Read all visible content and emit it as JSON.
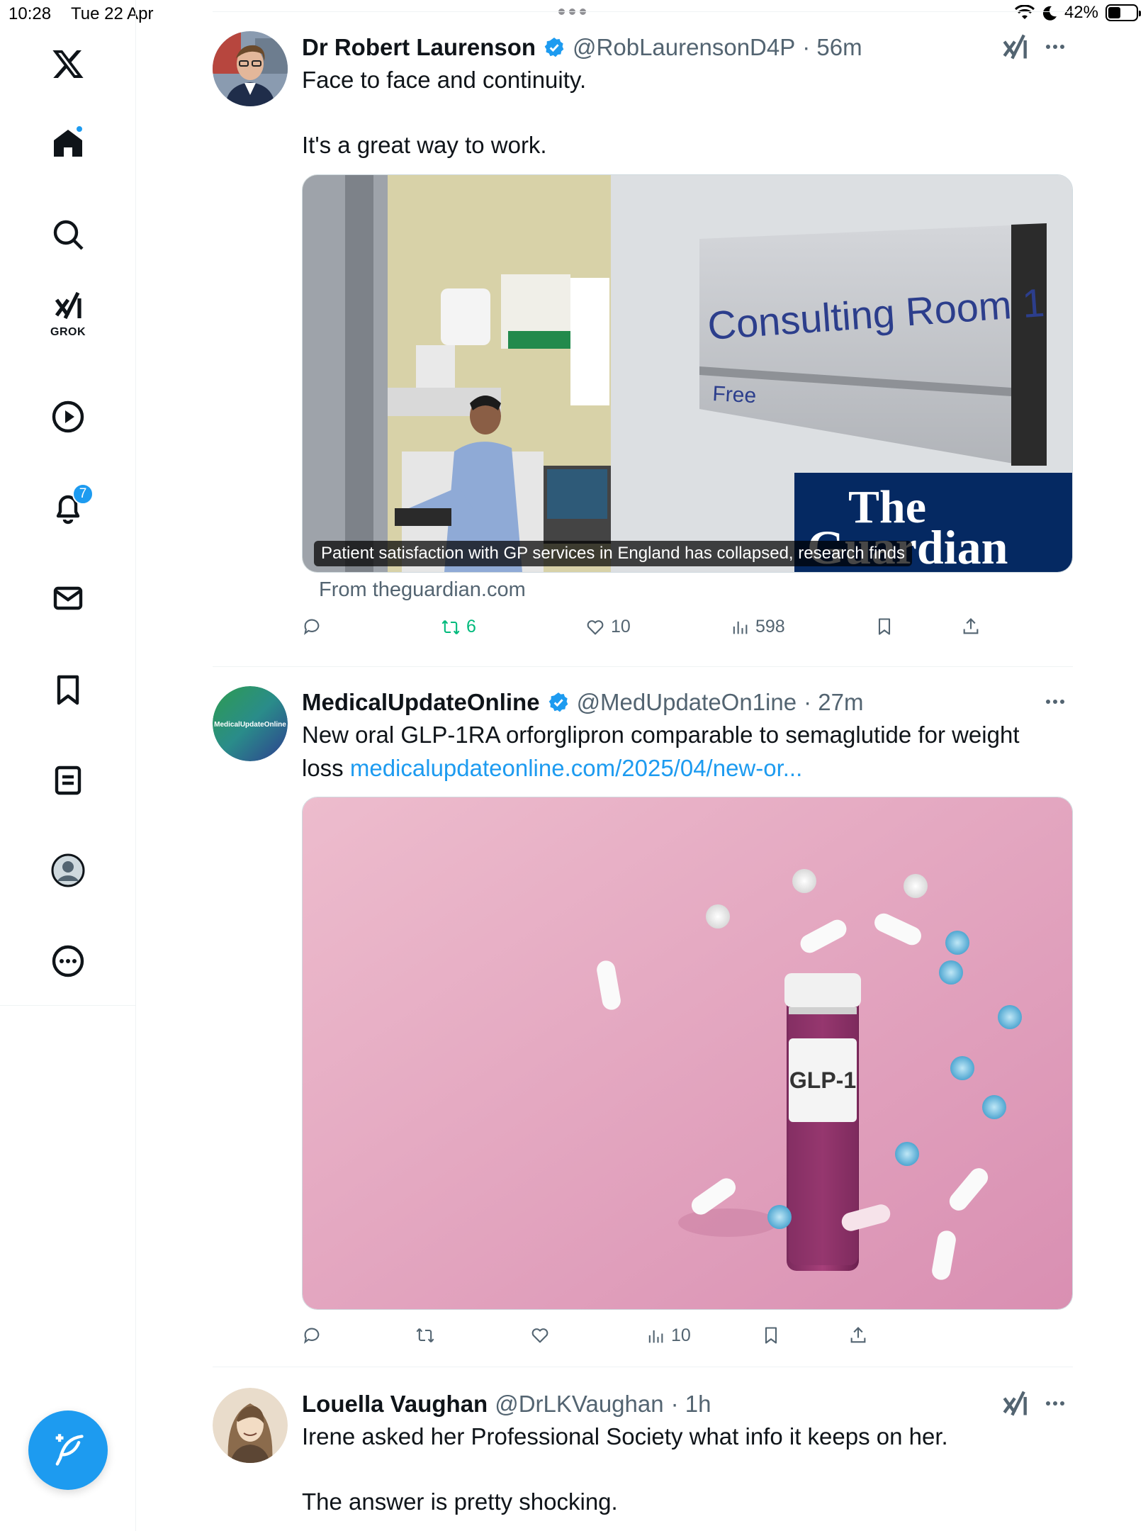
{
  "status_bar": {
    "time": "10:28",
    "date": "Tue 22 Apr",
    "battery": "42%"
  },
  "sidebar": {
    "items": [
      {
        "name": "home",
        "icon": "home-icon"
      },
      {
        "name": "explore",
        "icon": "search-icon"
      },
      {
        "name": "grok",
        "icon": "grok-icon",
        "label": "GROK"
      },
      {
        "name": "videos",
        "icon": "play-icon"
      },
      {
        "name": "notifications",
        "icon": "bell-icon",
        "badge": "7"
      },
      {
        "name": "messages",
        "icon": "envelope-icon"
      },
      {
        "name": "bookmarks",
        "icon": "bookmark-icon"
      },
      {
        "name": "lists",
        "icon": "list-icon"
      },
      {
        "name": "profile",
        "icon": "profile-icon"
      },
      {
        "name": "more",
        "icon": "more-icon"
      }
    ],
    "compose_icon": "feather-plus-icon"
  },
  "tweets": [
    {
      "name": "Dr Robert Laurenson",
      "handle": "@RobLaurensonD4P",
      "time": "· 56m",
      "line1": "Face to face and continuity.",
      "line2": "It's a great way to work.",
      "card": {
        "room_sign": "Consulting Room 1",
        "sign_status": "Free",
        "logo_line1": "The",
        "logo_line2": "Guardian",
        "caption": "Patient satisfaction with GP services in England has collapsed, research finds",
        "source": "From theguardian.com"
      },
      "stats": {
        "reposts": "6",
        "likes": "10",
        "views": "598"
      }
    },
    {
      "name": "MedicalUpdateOnline",
      "handle": "@MedUpdateOn1ine",
      "time": "· 27m",
      "avatar_text": "MedicalUpdateOnline",
      "line1": "New oral GLP-1RA orforglipron comparable to semaglutide for weight",
      "line2_text": "loss ",
      "line2_link": "medicalupdateonline.com/2025/04/new-or...",
      "image": {
        "bottle_label": "GLP-1"
      },
      "stats": {
        "views": "10"
      }
    },
    {
      "name": "Louella Vaughan",
      "handle": "@DrLKVaughan",
      "time": "· 1h",
      "line1": "Irene asked her Professional Society what info it keeps on her.",
      "line2": "The answer is pretty shocking."
    }
  ],
  "colors": {
    "accent": "#1d9bf0",
    "repost_active": "#00ba7c",
    "muted": "#536471",
    "guardian_blue": "#052962"
  }
}
